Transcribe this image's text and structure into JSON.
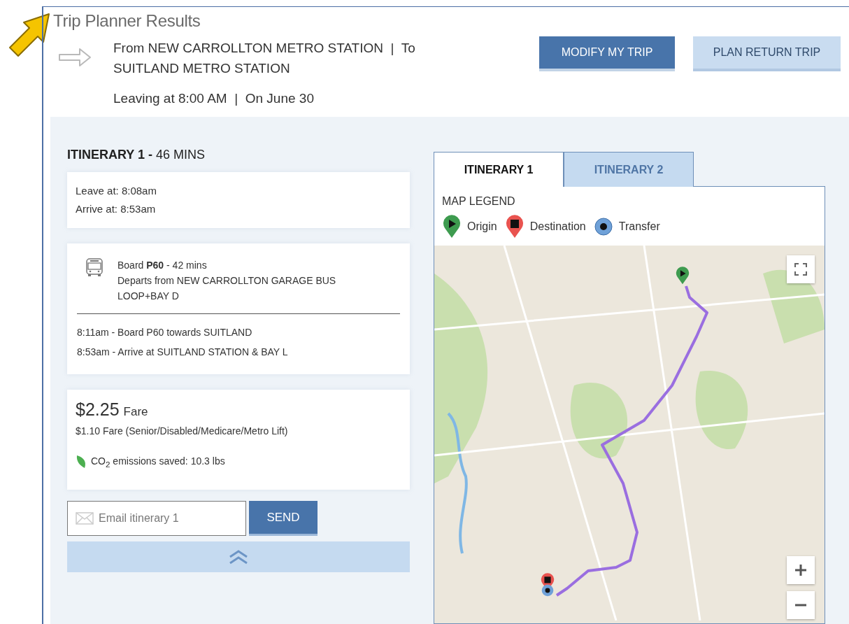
{
  "title": "Trip Planner Results",
  "trip": {
    "route": "From NEW CARROLLTON METRO STATION  |  To SUITLAND METRO STATION",
    "timing": "Leaving at 8:00 AM  |  On June 30"
  },
  "buttons": [
    {
      "label": "MODIFY MY TRIP",
      "kind": "primary"
    },
    {
      "label": "PLAN RETURN TRIP",
      "kind": "secondary"
    }
  ],
  "itinerary": {
    "heading": "**ITINERARY 1 -** 46 MINS",
    "leave": "Leave at: 8:08am",
    "arrive": "Arrive at: 8:53am",
    "leg": {
      "title": "Board **P60** - 42 mins",
      "departs": "Departs from NEW CARROLLTON GARAGE BUS LOOP+BAY D",
      "steps": [
        "8:11am - Board P60 towards SUITLAND",
        "8:53am - Arrive at SUITLAND STATION & BAY L"
      ]
    },
    "fare": {
      "amount": "$2.25",
      "label": "Fare",
      "reduced": "$1.10 Fare (Senior/Disabled/Medicare/Metro Lift)",
      "emissions": "CO$_{2}$ emissions saved: 10.3 lbs"
    },
    "email": {
      "placeholder": "Email itinerary 1",
      "button": "SEND"
    }
  },
  "tabs": [
    {
      "label": "ITINERARY 1",
      "selected": true
    },
    {
      "label": "ITINERARY 2",
      "selected": false
    }
  ],
  "legend": {
    "title": "MAP LEGEND",
    "items": [
      {
        "label": "Origin",
        "kind": "origin",
        "color": "#3e9b4f"
      },
      {
        "label": "Destination",
        "kind": "destination",
        "color": "#e9534f"
      },
      {
        "label": "Transfer",
        "kind": "transfer",
        "color": "#6fa1d8"
      }
    ]
  }
}
